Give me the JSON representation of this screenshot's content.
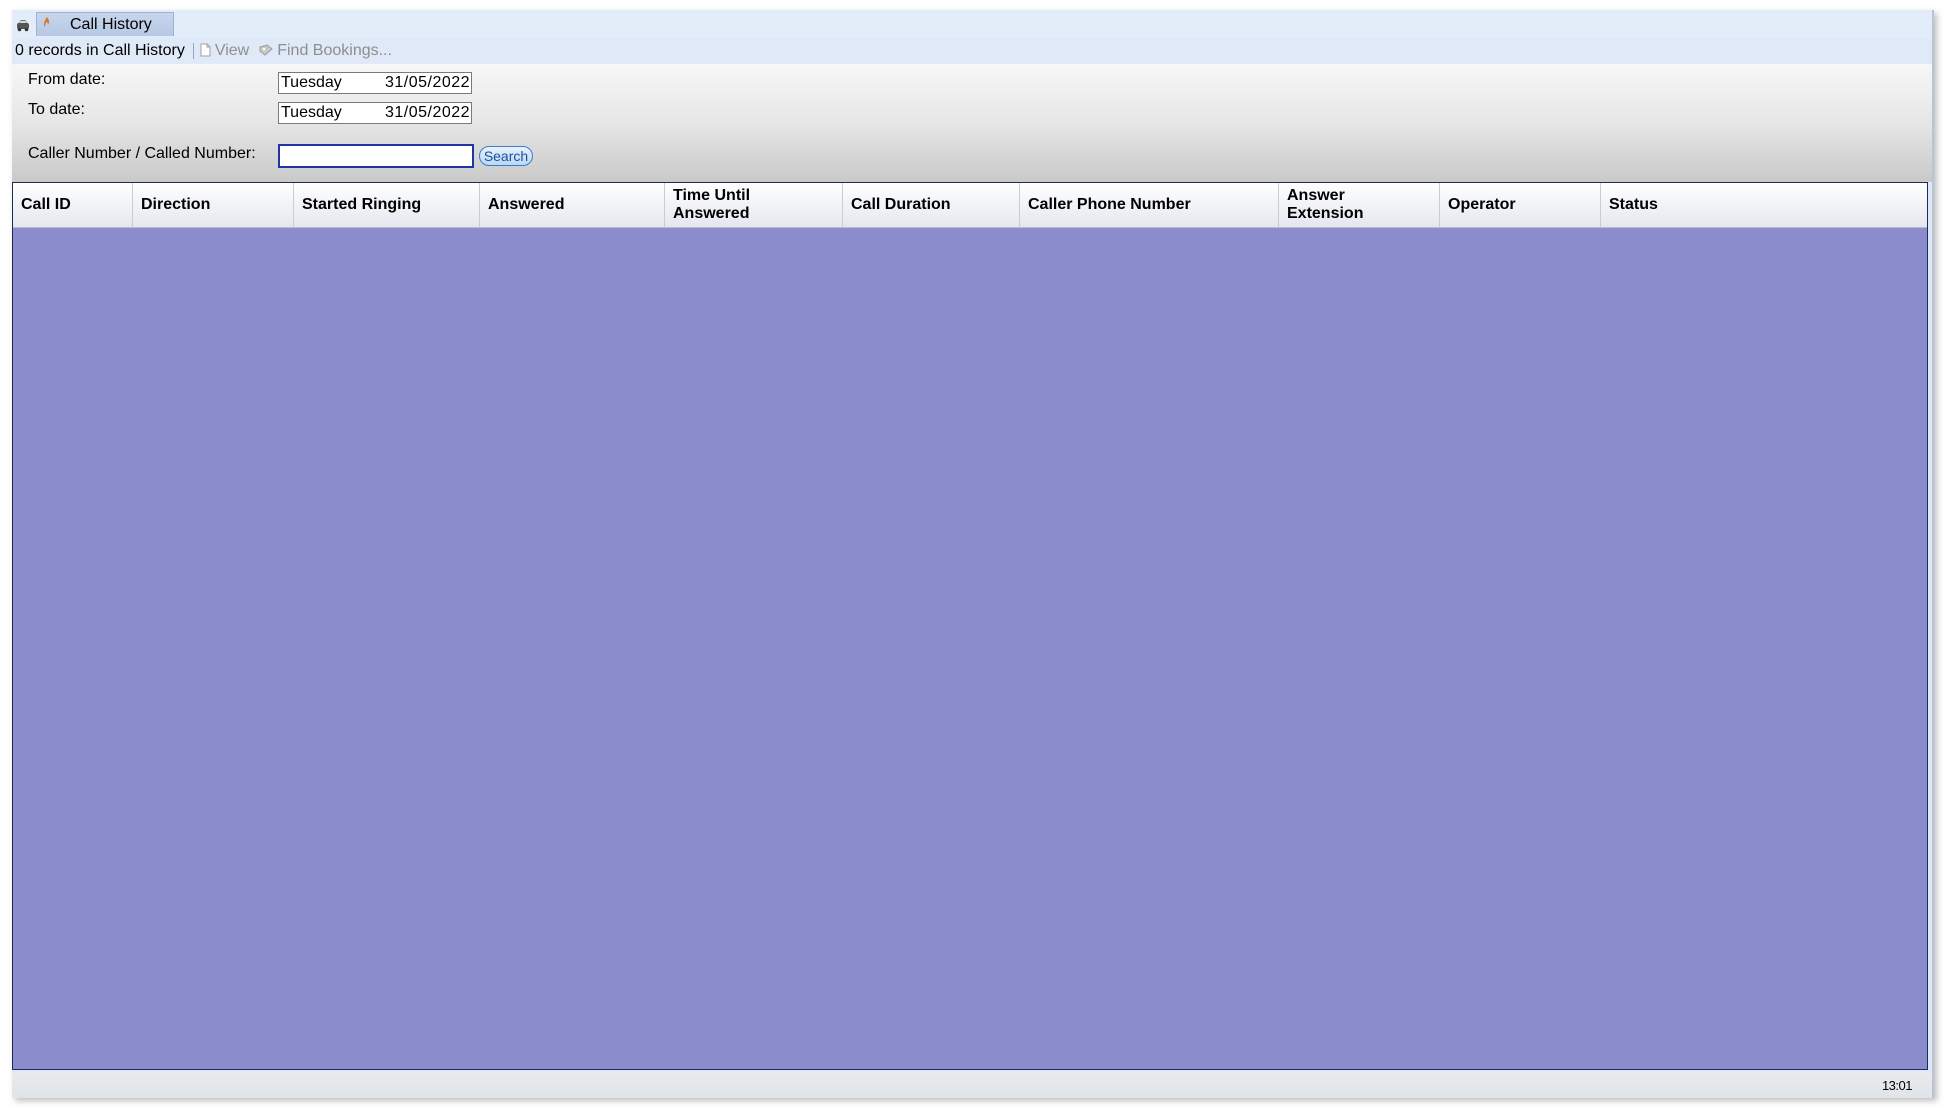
{
  "app": {
    "tab_title": "Call History"
  },
  "toolbar": {
    "records_text": "0 records in Call History",
    "view_label": "View",
    "find_bookings_label": "Find Bookings..."
  },
  "filter": {
    "from_label": "From date:",
    "from_day": "Tuesday",
    "from_date": "31/05/2022",
    "to_label": "To date:",
    "to_day": "Tuesday",
    "to_date": "31/05/2022",
    "number_label": "Caller Number / Called Number:",
    "number_value": "",
    "search_label": "Search"
  },
  "grid": {
    "columns": [
      "Call ID",
      "Direction",
      "Started Ringing",
      "Answered",
      "Time Until\nAnswered",
      "Call Duration",
      "Caller Phone Number",
      "Answer\nExtension",
      "Operator",
      "Status"
    ],
    "rows": []
  },
  "statusbar": {
    "clock": "13:01"
  },
  "colors": {
    "grid_background": "#8a8ccb",
    "window_background": "#dfe9f8",
    "search_border": "#3d7cc7",
    "input_focus_border": "#2233aa"
  }
}
